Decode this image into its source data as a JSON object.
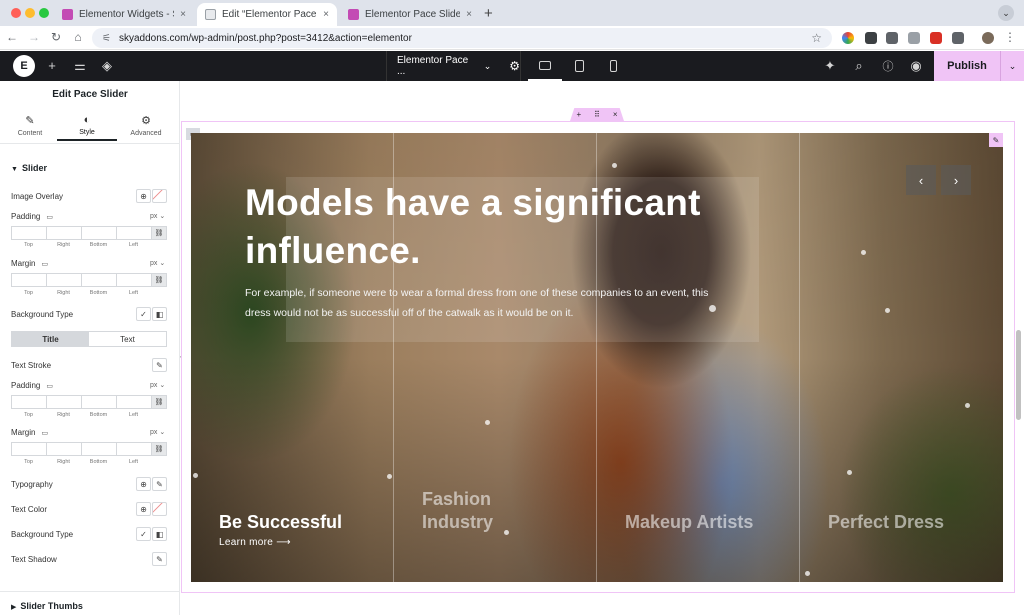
{
  "browser": {
    "tabs": [
      {
        "label": "Elementor Widgets - Sky Addons",
        "active": false,
        "favicon_color": "#c34bb4"
      },
      {
        "label": "Edit “Elementor Pace Slider Widget”",
        "active": true,
        "favicon_color": "#5f6368"
      },
      {
        "label": "Elementor Pace Slider Widget",
        "active": false,
        "favicon_color": "#c34bb4"
      }
    ],
    "close_glyph": "×",
    "new_tab_glyph": "+",
    "tab_menu_glyph": "⌄",
    "url": "skyaddons.com/wp-admin/post.php?post=3412&action=elementor",
    "traffic_colors": [
      "#ff5f57",
      "#febc2e",
      "#28c840"
    ]
  },
  "editor_bar": {
    "logo": "E",
    "page_name": "Elementor Pace ...",
    "publish_label": "Publish",
    "accent": "#f0c4f6"
  },
  "panel": {
    "title": "Edit Pace Slider",
    "tabs": [
      {
        "label": "Content",
        "icon": "pencil-icon",
        "glyph": "✎"
      },
      {
        "label": "Style",
        "icon": "contrast-icon",
        "glyph": "◐"
      },
      {
        "label": "Advanced",
        "icon": "gear-icon",
        "glyph": "⚙"
      }
    ],
    "slider_section": "Slider",
    "image_overlay": "Image Overlay",
    "padding": "Padding",
    "margin": "Margin",
    "unit": "px",
    "dim_labels": [
      "Top",
      "Right",
      "Bottom",
      "Left"
    ],
    "background_type": "Background Type",
    "seg_title": "Title",
    "seg_text": "Text",
    "text_stroke": "Text Stroke",
    "typography": "Typography",
    "text_color": "Text Color",
    "text_shadow": "Text Shadow",
    "slider_thumbs": "Slider Thumbs"
  },
  "slide": {
    "title": "Models have a significant influence.",
    "description": "For example, if someone were to wear a formal dress from one of these companies to an event, this dress would not be as successful off of the catwalk as it would be on it.",
    "learn_more": "Learn more ⟶",
    "prev": "‹",
    "next": "›"
  },
  "thumbs": [
    {
      "label": "Be Successful",
      "active": true
    },
    {
      "label": "Fashion Industry",
      "active": false
    },
    {
      "label": "Makeup Artists",
      "active": false
    },
    {
      "label": "Perfect Dress",
      "active": false
    }
  ]
}
